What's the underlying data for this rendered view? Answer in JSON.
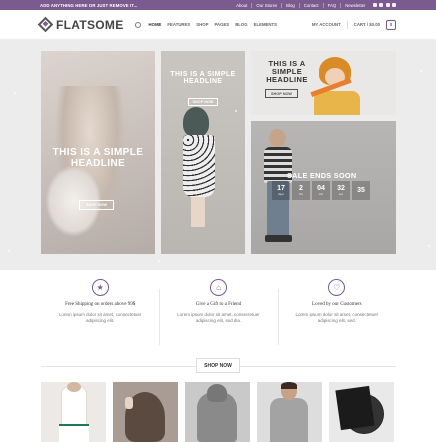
{
  "topbar": {
    "promo": "ADD ANYTHING HERE OR JUST REMOVE IT...",
    "links": [
      "About",
      "Our Stores",
      "Blog",
      "Contact",
      "FAQ",
      "Newsletter"
    ]
  },
  "header": {
    "logo": "FLATSOME",
    "nav": [
      "HOME",
      "FEATURES",
      "SHOP",
      "PAGES",
      "BLOG",
      "ELEMENTS"
    ],
    "account": "MY ACCOUNT",
    "cart": "CART / $0.00",
    "cart_count": "0"
  },
  "banner": {
    "tile1": {
      "headline": "THIS IS A SIMPLE HEADLINE",
      "button": "SHOP NOW"
    },
    "tile2": {
      "headline": "THIS IS A SIMPLE HEADLINE",
      "button": "SHOP NOW"
    },
    "tile3": {
      "headline": "THIS IS A SIMPLE HEADLINE",
      "button": "SHOP NOW"
    },
    "sale": {
      "title": "SALE ENDS SOON",
      "countdown": [
        {
          "value": "17",
          "unit": "days"
        },
        {
          "value": "2",
          "unit": "hrs"
        },
        {
          "value": "04",
          "unit": "min"
        },
        {
          "value": "32",
          "unit": "sec"
        },
        {
          "value": "35",
          "unit": ""
        }
      ]
    }
  },
  "features": [
    {
      "icon": "star-icon",
      "glyph": "★",
      "title": "Free Shipping on orders above 99$",
      "text": "Lorem ipsum dolor sit amet, consectetuer adipiscing elit."
    },
    {
      "icon": "gift-icon",
      "glyph": "⌂",
      "title": "Give a Gift to a Friend",
      "text": "Lorem ipsum dolor sit amet, consectetuer adipiscing elit, sed dia."
    },
    {
      "icon": "heart-icon",
      "glyph": "♡",
      "title": "Loved by our Customers",
      "text": "Lorem ipsum dolor sit amet, consectetuer adipiscing elit, sed."
    }
  ],
  "shop_now": "SHOP NOW",
  "colors": {
    "accent": "#7a5a8f",
    "topbar": "#7a5a8f"
  }
}
